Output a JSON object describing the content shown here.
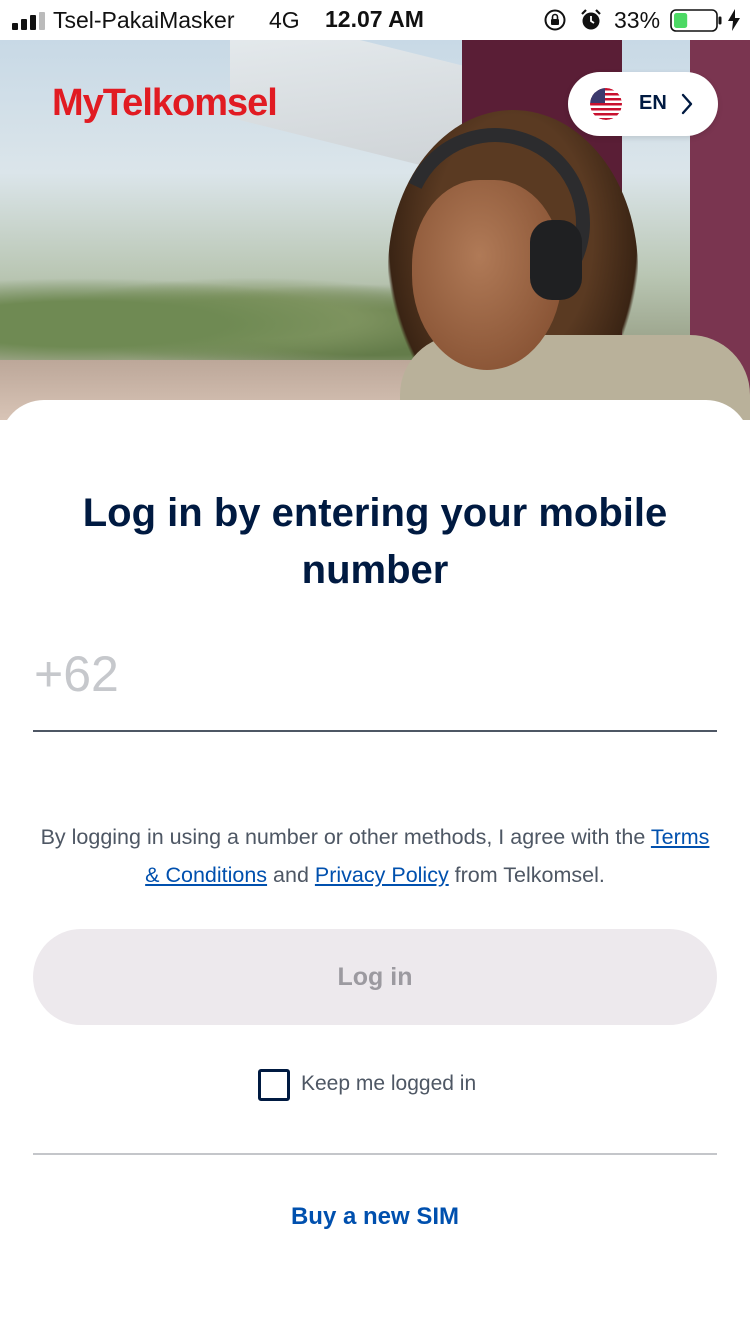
{
  "status_bar": {
    "carrier": "Tsel-PakaiMasker",
    "network": "4G",
    "time": "12.07 AM",
    "battery_percent": "33%",
    "battery_level": 0.33,
    "icons": [
      "signal-icon",
      "orientation-lock-icon",
      "alarm-icon",
      "battery-icon",
      "charging-icon"
    ]
  },
  "header": {
    "logo_text": "MyTelkomsel",
    "language": {
      "label": "EN",
      "flag": "us-flag-icon"
    }
  },
  "login": {
    "title": "Log in by entering your mobile number",
    "phone_prefix": "+62",
    "phone_value": "",
    "terms_prefix": "By logging in using a number or other methods, I agree with the ",
    "terms_link": "Terms & Conditions",
    "terms_and": " and ",
    "privacy_link": "Privacy Policy",
    "terms_suffix": " from Telkomsel.",
    "login_button": "Log in",
    "keep_logged_in": "Keep me logged in",
    "buy_sim": "Buy a new SIM"
  },
  "colors": {
    "brand_red": "#e11b22",
    "title_navy": "#001a41",
    "link_blue": "#0050ae",
    "button_disabled_bg": "#ede9ed",
    "button_disabled_text": "#9c9aa0"
  }
}
